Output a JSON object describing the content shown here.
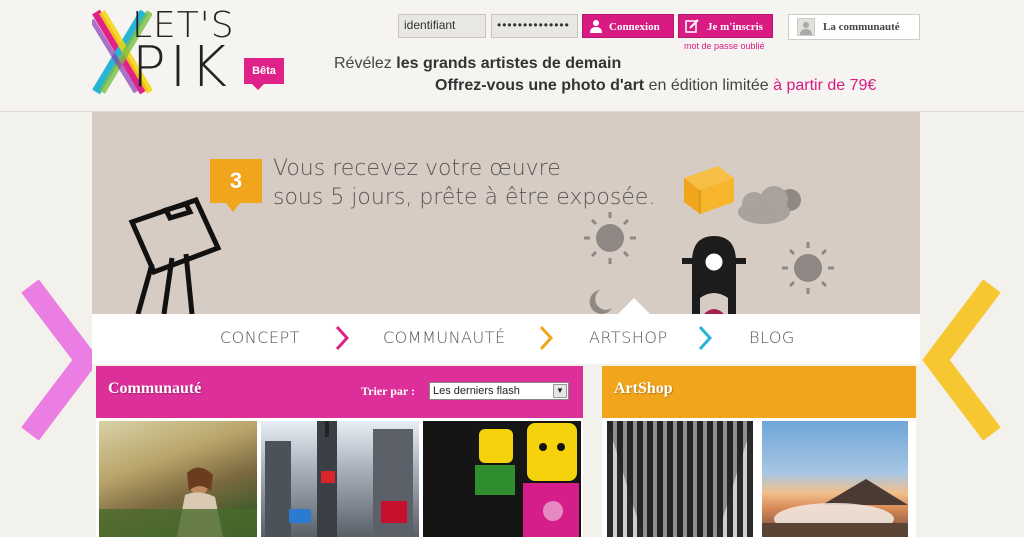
{
  "header": {
    "logo_lets": "LET'S",
    "logo_pik": "PIK",
    "beta": "Bêta",
    "login_value": "identifiant",
    "password_value": "••••••••••••••",
    "connexion": "Connexion",
    "inscris": "Je m'inscris",
    "forgot": "mot de passe oublié",
    "community": "La communauté",
    "tagline1_a": "Révélez ",
    "tagline1_b": "les grands artistes de demain",
    "tagline2_a": "Offrez-vous une photo d'art",
    "tagline2_b": " en édition limitée ",
    "tagline2_c": "à partir de 79€"
  },
  "banner": {
    "step": "3",
    "line1": "Vous recevez votre œuvre",
    "line2": "sous 5 jours, prête à être exposée."
  },
  "nav": {
    "items": [
      "CONCEPT",
      "COMMUNAUTÉ",
      "ARTSHOP",
      "BLOG"
    ]
  },
  "community": {
    "title": "Communauté",
    "sort_label": "Trier par :",
    "sort_value": "Les derniers flash"
  },
  "artshop": {
    "title": "ArtShop"
  },
  "colors": {
    "pink": "#d81b83",
    "orange": "#f0a51c",
    "cyan": "#27b5d6",
    "banner": "#d7ccc4"
  }
}
